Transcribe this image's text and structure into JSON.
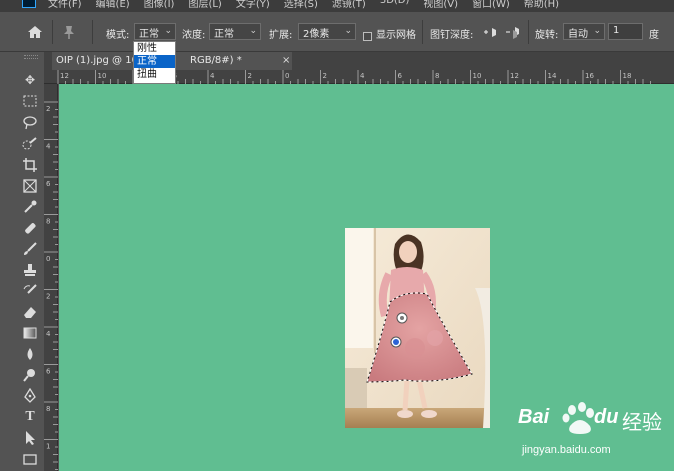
{
  "menu": {
    "items": [
      "文件(F)",
      "编辑(E)",
      "图像(I)",
      "图层(L)",
      "文字(Y)",
      "选择(S)",
      "滤镜(T)",
      "3D(D)",
      "视图(V)",
      "窗口(W)",
      "帮助(H)"
    ]
  },
  "options": {
    "mode_label": "模式:",
    "mode_value": "正常",
    "density_label": "浓度:",
    "density_value": "正常",
    "expand_label": "扩展:",
    "expand_value": "2像素",
    "show_grid_label": "显示网格",
    "pin_depth_label": "图钉深度:",
    "rotate_label": "旋转:",
    "rotate_value": "自动",
    "angle_value": "1",
    "angle_unit": "度"
  },
  "mode_dropdown": {
    "options": [
      "刚性",
      "正常",
      "扭曲"
    ],
    "selected": "正常"
  },
  "tab": {
    "title": "OIP (1).jpg @ 100",
    "title_rest": "RGB/8#) *",
    "close": "×"
  },
  "ruler": {
    "h_labels": [
      "12",
      "10",
      "8",
      "6",
      "4",
      "2",
      "0",
      "2",
      "4",
      "6",
      "8",
      "10",
      "12",
      "14",
      "16",
      "18"
    ],
    "v_labels": [
      "2",
      "4",
      "6",
      "8",
      "0",
      "2",
      "4",
      "6",
      "8",
      "1"
    ]
  },
  "watermark": {
    "brand": "Bai",
    "brand_suffix": "du",
    "product": "经验",
    "url": "jingyan.baidu.com"
  },
  "colors": {
    "canvas": "#60be91",
    "ui_bg": "#535353",
    "selection_blue": "#0a64c8"
  },
  "icons": {
    "home": "home-icon",
    "pin": "pin-icon",
    "pin_depth_up": "pin-forward-icon",
    "pin_depth_down": "pin-backward-icon"
  }
}
